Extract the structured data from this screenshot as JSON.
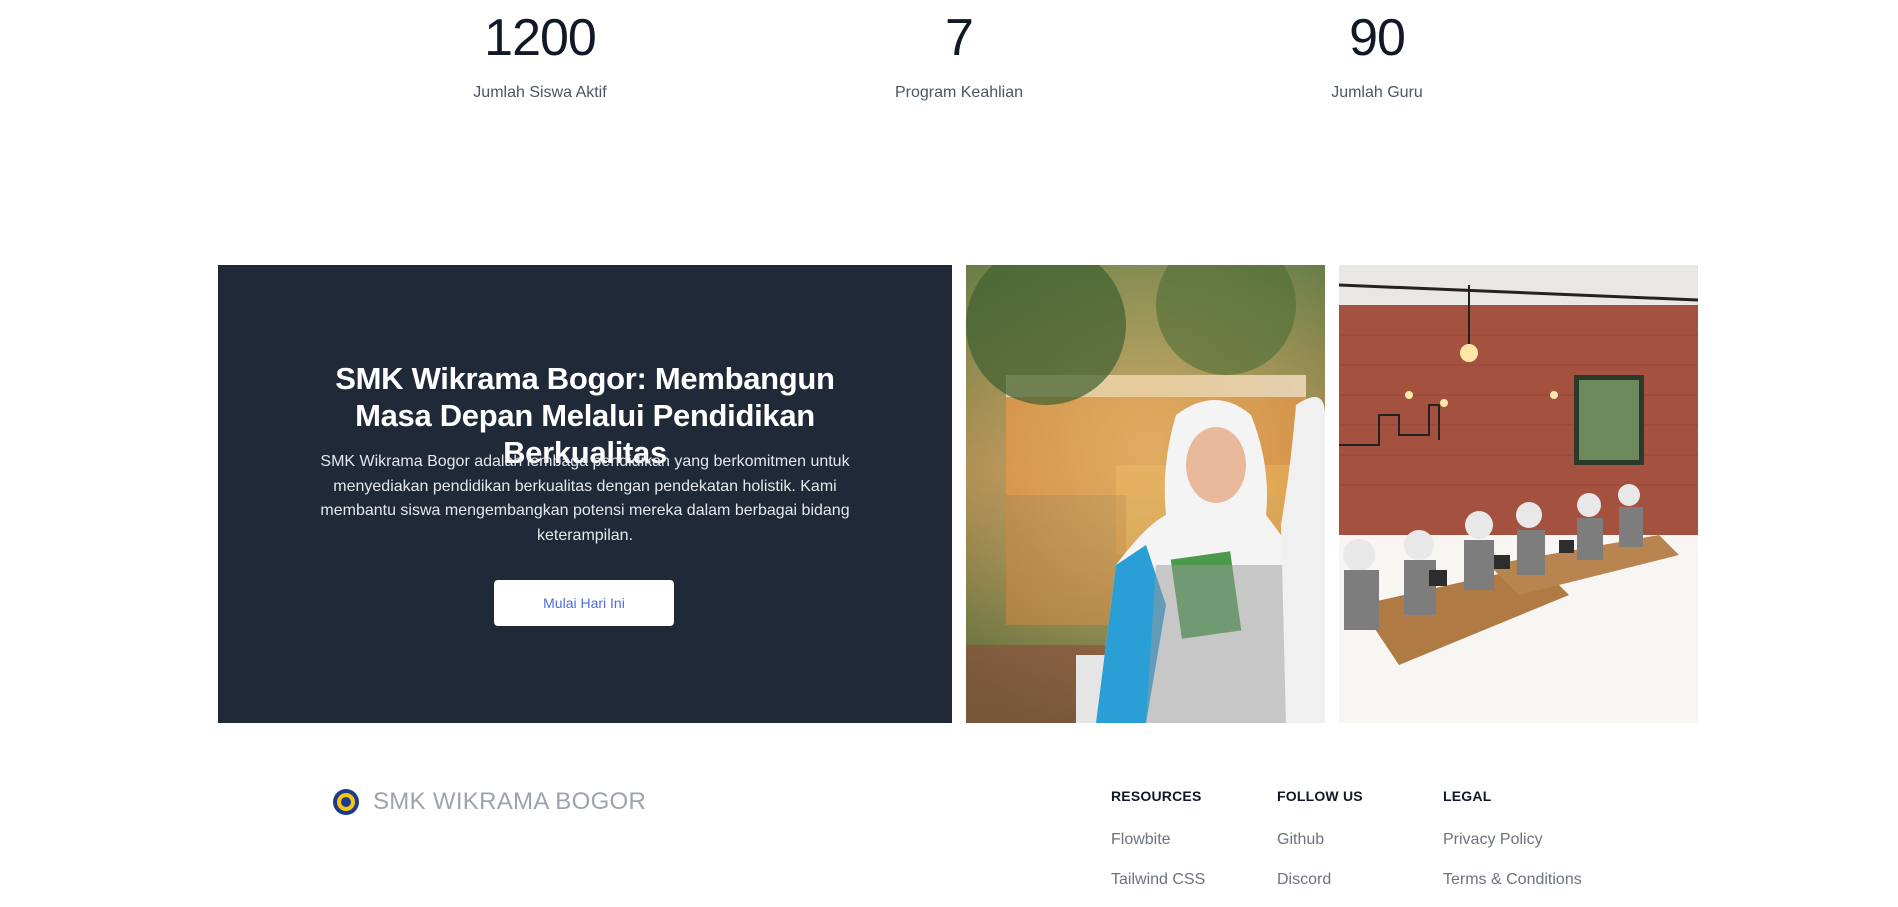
{
  "stats": [
    {
      "value": "1200",
      "label": "Jumlah Siswa Aktif"
    },
    {
      "value": "7",
      "label": "Program Keahlian"
    },
    {
      "value": "90",
      "label": "Jumlah Guru"
    }
  ],
  "cta": {
    "title": "SMK Wikrama Bogor: Membangun Masa Depan Melalui Pendidikan Berkualitas",
    "description": "SMK Wikrama Bogor adalah lembaga pendidikan yang berkomitmen untuk menyediakan pendidikan berkualitas dengan pendekatan holistik. Kami membantu siswa mengembangkan potensi mereka dalam berbagai bidang keterampilan.",
    "button_label": "Mulai Hari Ini",
    "background_color": "#1f2937"
  },
  "footer": {
    "brand": "SMK WIKRAMA BOGOR",
    "columns": [
      {
        "heading": "RESOURCES",
        "links": [
          "Flowbite",
          "Tailwind CSS"
        ]
      },
      {
        "heading": "FOLLOW US",
        "links": [
          "Github",
          "Discord"
        ]
      },
      {
        "heading": "LEGAL",
        "links": [
          "Privacy Policy",
          "Terms & Conditions"
        ]
      }
    ]
  }
}
